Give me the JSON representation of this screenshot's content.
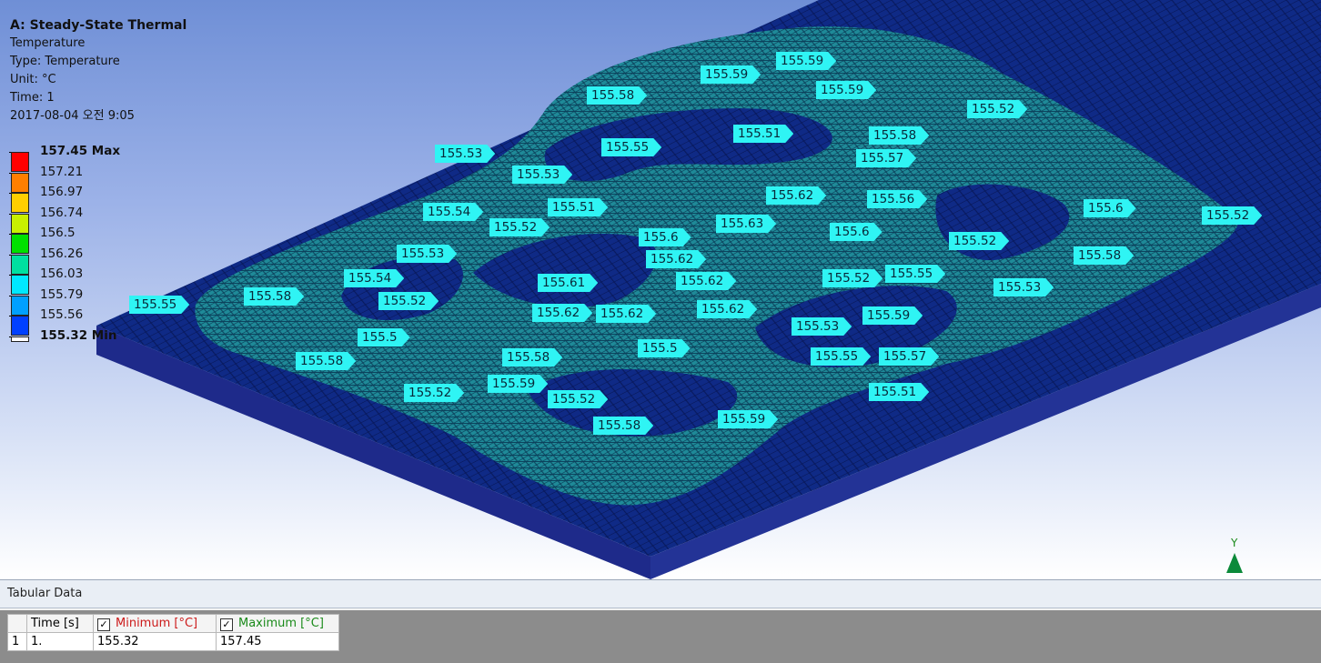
{
  "info": {
    "title": "A: Steady-State Thermal",
    "result": "Temperature",
    "type": "Type: Temperature",
    "unit": "Unit: °C",
    "time": "Time: 1",
    "timestamp": "2017-08-04 오전 9:05"
  },
  "legend": {
    "max_label": "157.45 Max",
    "min_label": "155.32 Min",
    "levels": [
      "157.21",
      "156.97",
      "156.74",
      "156.5",
      "156.26",
      "156.03",
      "155.79",
      "155.56"
    ],
    "colors": [
      "#ff0000",
      "#ff7f00",
      "#ffcf00",
      "#c8f000",
      "#00e000",
      "#00e0a0",
      "#00e8ff",
      "#00a0ff",
      "#0040ff"
    ]
  },
  "probes": [
    "155.59",
    "155.59",
    "155.58",
    "155.59",
    "155.52",
    "155.51",
    "155.58",
    "155.53",
    "155.55",
    "155.57",
    "155.53",
    "155.62",
    "155.56",
    "155.54",
    "155.51",
    "155.6",
    "155.52",
    "155.63",
    "155.6",
    "155.52",
    "155.52",
    "155.53",
    "155.62",
    "155.6",
    "155.54",
    "155.62",
    "155.55",
    "155.61",
    "155.52",
    "155.58",
    "155.55",
    "155.58",
    "155.52",
    "155.62",
    "155.62",
    "155.62",
    "155.53",
    "155.5",
    "155.53",
    "155.59",
    "155.5",
    "155.55",
    "155.57",
    "155.58",
    "155.58",
    "155.59",
    "155.52",
    "155.52",
    "155.51",
    "155.58",
    "155.59"
  ],
  "triad": {
    "axis_label": "Y"
  },
  "tabular": {
    "title": "Tabular Data",
    "columns": [
      "Time [s]",
      "Minimum [°C]",
      "Maximum [°C]"
    ],
    "checkmark": "✓",
    "rows": [
      {
        "index": "1",
        "time": "1.",
        "min": "155.32",
        "max": "157.45"
      }
    ],
    "min_color": "#cc1a1a",
    "max_color": "#1a8a1a"
  }
}
